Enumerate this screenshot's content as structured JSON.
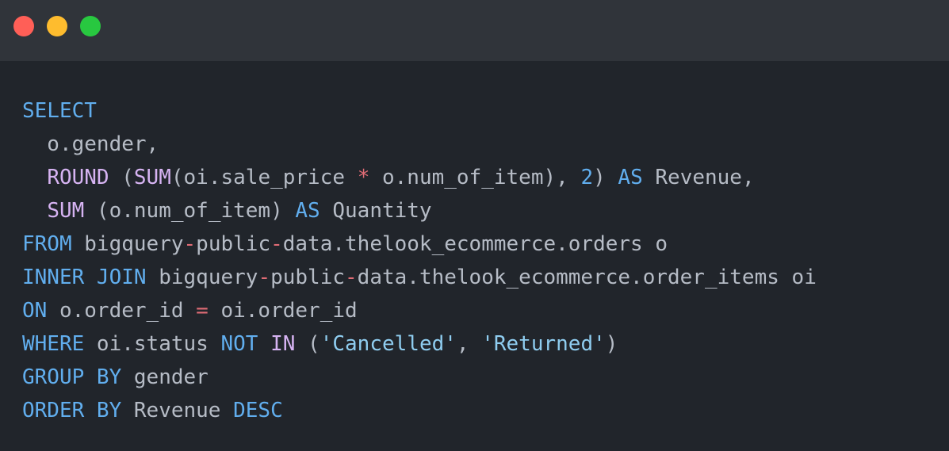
{
  "window": {
    "controls": [
      {
        "name": "close",
        "color": "#ff5f57"
      },
      {
        "name": "minimize",
        "color": "#febc2e"
      },
      {
        "name": "maximize",
        "color": "#28c840"
      }
    ]
  },
  "code": {
    "language": "sql",
    "colors": {
      "keyword": "#61aeee",
      "function": "#d6b3f2",
      "operator": "#e06c75",
      "string": "#8fcdf0",
      "text": "#b6bcc6",
      "background": "#21252b",
      "titlebar": "#30343a"
    },
    "lines": [
      [
        {
          "t": "SELECT",
          "c": "kw"
        }
      ],
      [
        {
          "t": "  o.gender,",
          "c": "tx"
        }
      ],
      [
        {
          "t": "  ",
          "c": "tx"
        },
        {
          "t": "ROUND",
          "c": "fn"
        },
        {
          "t": " (",
          "c": "tx"
        },
        {
          "t": "SUM",
          "c": "fn"
        },
        {
          "t": "(oi.sale_price ",
          "c": "tx"
        },
        {
          "t": "*",
          "c": "op"
        },
        {
          "t": " o.num_of_item), ",
          "c": "tx"
        },
        {
          "t": "2",
          "c": "num"
        },
        {
          "t": ") ",
          "c": "tx"
        },
        {
          "t": "AS",
          "c": "kw"
        },
        {
          "t": " Revenue,",
          "c": "tx"
        }
      ],
      [
        {
          "t": "  ",
          "c": "tx"
        },
        {
          "t": "SUM",
          "c": "fn"
        },
        {
          "t": " (o.num_of_item) ",
          "c": "tx"
        },
        {
          "t": "AS",
          "c": "kw"
        },
        {
          "t": " Quantity",
          "c": "tx"
        }
      ],
      [
        {
          "t": "FROM",
          "c": "kw"
        },
        {
          "t": " bigquery",
          "c": "tx"
        },
        {
          "t": "-",
          "c": "op"
        },
        {
          "t": "public",
          "c": "tx"
        },
        {
          "t": "-",
          "c": "op"
        },
        {
          "t": "data.thelook_ecommerce.orders o",
          "c": "tx"
        }
      ],
      [
        {
          "t": "INNER JOIN",
          "c": "kw"
        },
        {
          "t": " bigquery",
          "c": "tx"
        },
        {
          "t": "-",
          "c": "op"
        },
        {
          "t": "public",
          "c": "tx"
        },
        {
          "t": "-",
          "c": "op"
        },
        {
          "t": "data.thelook_ecommerce.order_items oi",
          "c": "tx"
        }
      ],
      [
        {
          "t": "ON",
          "c": "kw"
        },
        {
          "t": " o.order_id ",
          "c": "tx"
        },
        {
          "t": "=",
          "c": "op"
        },
        {
          "t": " oi.order_id",
          "c": "tx"
        }
      ],
      [
        {
          "t": "WHERE",
          "c": "kw"
        },
        {
          "t": " oi.status ",
          "c": "tx"
        },
        {
          "t": "NOT",
          "c": "kw"
        },
        {
          "t": " ",
          "c": "tx"
        },
        {
          "t": "IN",
          "c": "fn"
        },
        {
          "t": " (",
          "c": "tx"
        },
        {
          "t": "'Cancelled'",
          "c": "str"
        },
        {
          "t": ", ",
          "c": "tx"
        },
        {
          "t": "'Returned'",
          "c": "str"
        },
        {
          "t": ")",
          "c": "tx"
        }
      ],
      [
        {
          "t": "GROUP BY",
          "c": "kw"
        },
        {
          "t": " gender",
          "c": "tx"
        }
      ],
      [
        {
          "t": "ORDER BY",
          "c": "kw"
        },
        {
          "t": " Revenue ",
          "c": "tx"
        },
        {
          "t": "DESC",
          "c": "kw"
        }
      ]
    ]
  }
}
